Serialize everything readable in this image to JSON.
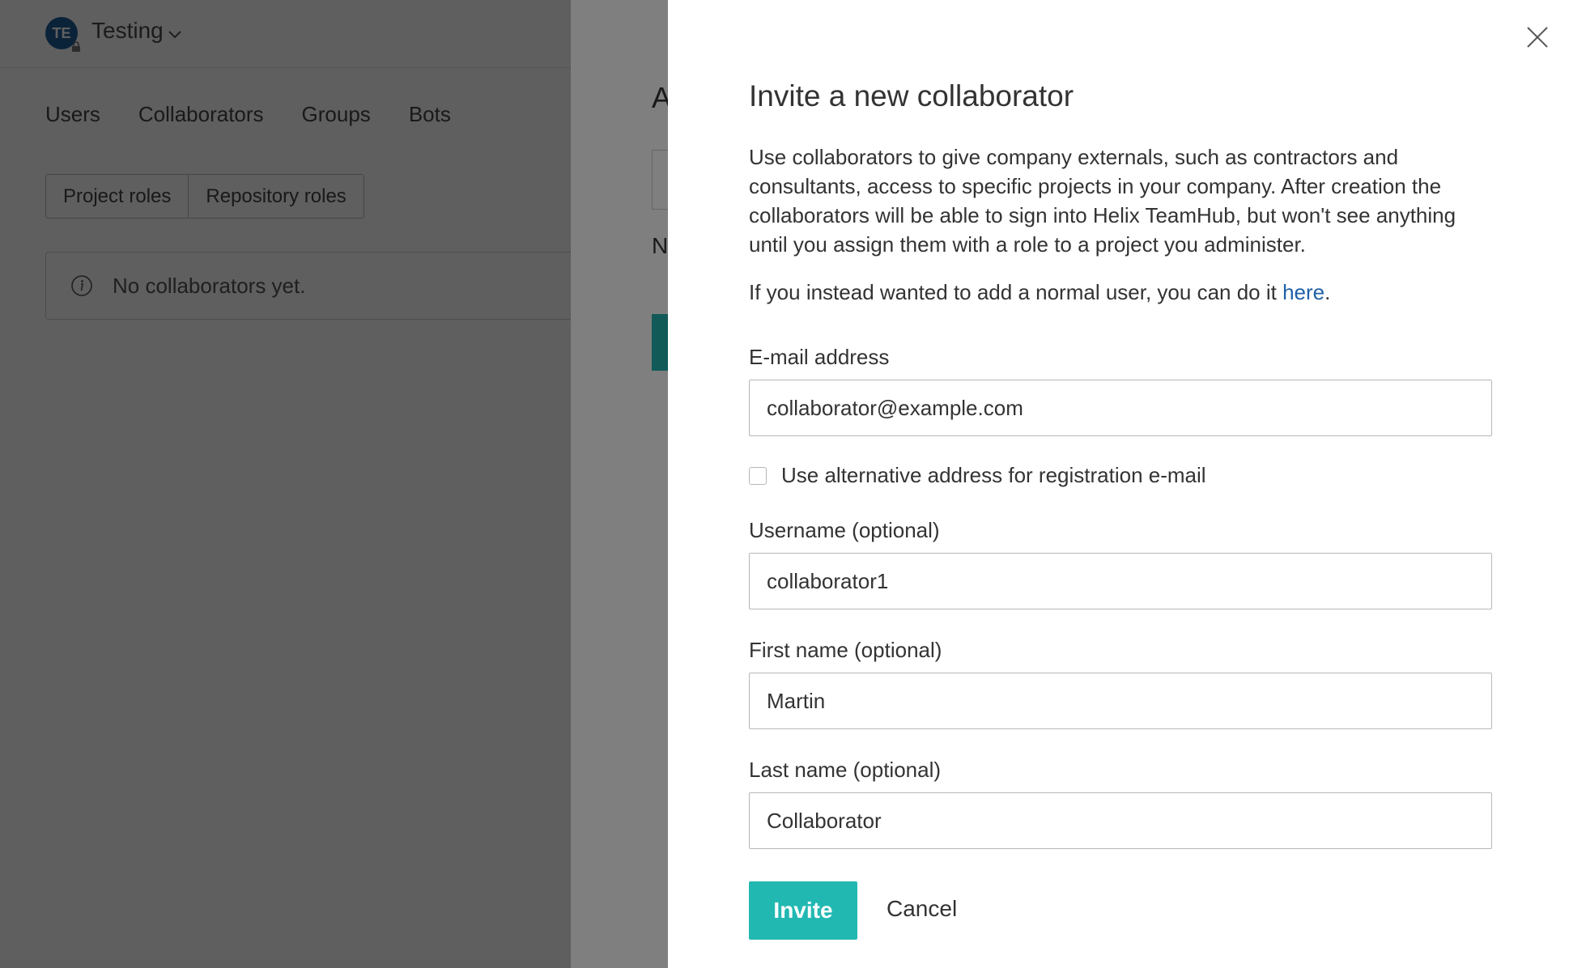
{
  "header": {
    "avatar_initials": "TE",
    "org_name": "Testing",
    "chevron_icon": "chevron-down-icon",
    "lock_icon": "lock-icon"
  },
  "nav": {
    "items": [
      {
        "label": "Users"
      },
      {
        "label": "Collaborators"
      },
      {
        "label": "Groups"
      },
      {
        "label": "Bots"
      }
    ]
  },
  "roles_toggle": {
    "project_roles": "Project roles",
    "repository_roles": "Repository roles"
  },
  "notice": {
    "icon": "info-icon",
    "text": "No collaborators yet."
  },
  "background_panel": {
    "title_fragment": "A",
    "label_fragment": "N"
  },
  "modal": {
    "title": "Invite a new collaborator",
    "description": "Use collaborators to give company externals, such as contractors and consultants, access to specific projects in your company. After creation the collaborators will be able to sign into Helix TeamHub, but won't see anything until you assign them with a role to a project you administer.",
    "alt_note_prefix": "If you instead wanted to add a normal user, you can do it ",
    "alt_note_link": "here",
    "alt_note_suffix": ".",
    "email_label": "E-mail address",
    "email_value": "collaborator@example.com",
    "alt_address_checkbox_label": "Use alternative address for registration e-mail",
    "alt_address_checked": false,
    "username_label": "Username (optional)",
    "username_value": "collaborator1",
    "first_name_label": "First name (optional)",
    "first_name_value": "Martin",
    "last_name_label": "Last name (optional)",
    "last_name_value": "Collaborator",
    "invite_label": "Invite",
    "cancel_label": "Cancel",
    "close_icon": "close-icon"
  },
  "colors": {
    "accent": "#22b8b2",
    "link": "#1d5fa8",
    "avatar": "#1e5f99"
  }
}
